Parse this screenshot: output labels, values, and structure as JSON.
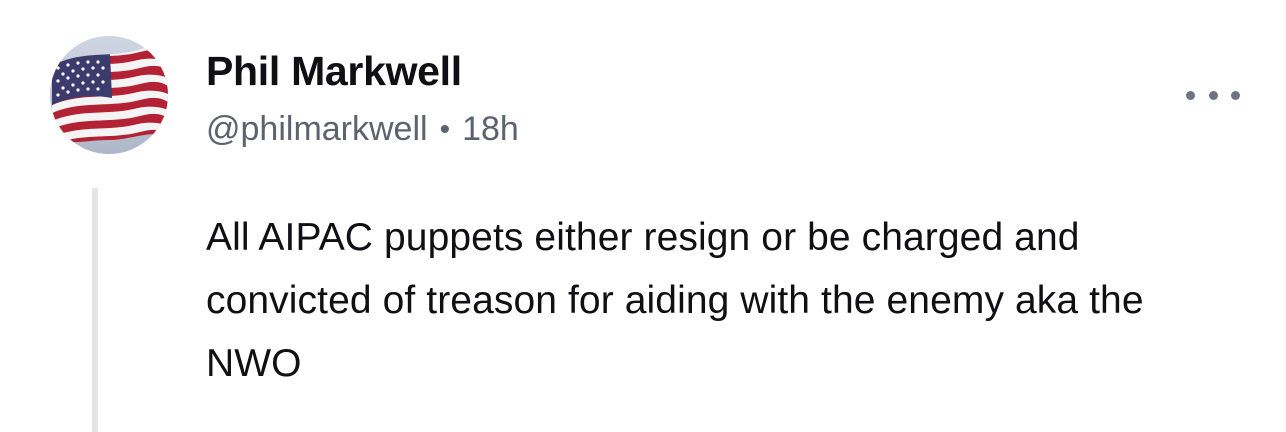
{
  "post": {
    "author": {
      "display_name": "Phil Markwell",
      "handle": "@philmarkwell",
      "avatar_icon": "american-flag-icon"
    },
    "separator": "•",
    "timestamp": "18h",
    "more_icon": "more-horizontal-icon",
    "text": "All AIPAC puppets either resign or be charged and convicted of treason for aiding with the enemy aka the NWO"
  },
  "colors": {
    "text_primary": "#0f0f14",
    "text_secondary": "#5d6270",
    "thread_line": "#e4e5e8",
    "flag_red": "#b22234",
    "flag_blue": "#3c3b6e"
  }
}
